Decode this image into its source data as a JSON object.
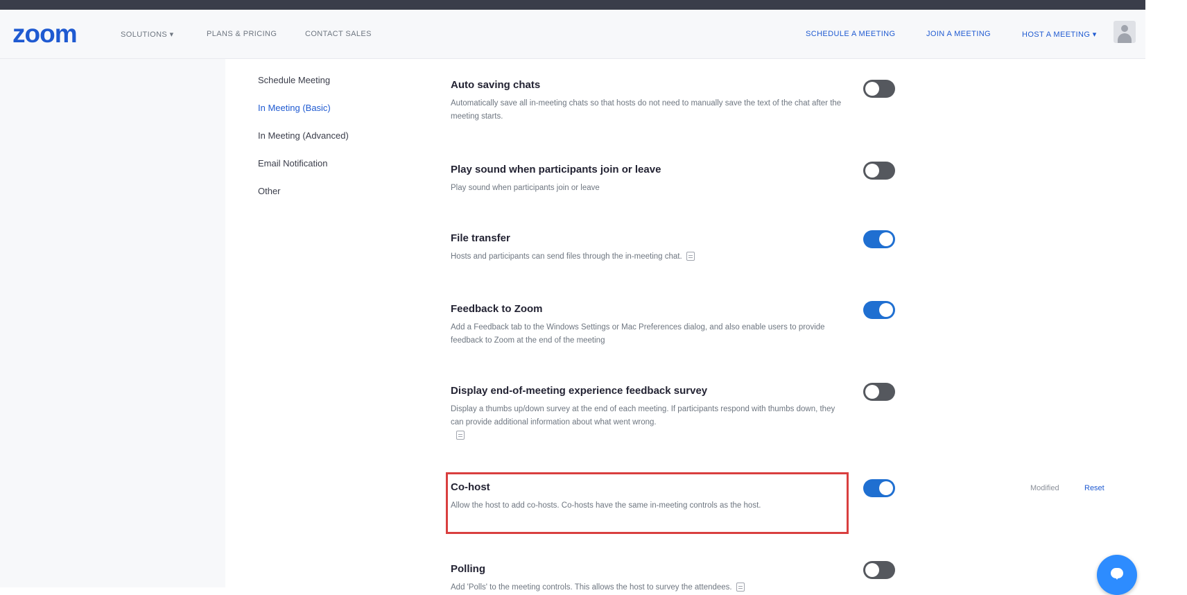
{
  "header": {
    "logo": "zoom",
    "nav_left": [
      "SOLUTIONS ▾",
      "PLANS & PRICING",
      "CONTACT SALES"
    ],
    "nav_right": [
      "SCHEDULE A MEETING",
      "JOIN A MEETING",
      "HOST A MEETING ▾"
    ],
    "avatar_icon": "user-avatar-icon"
  },
  "sidebar": {
    "items": [
      {
        "label": "Schedule Meeting",
        "active": false
      },
      {
        "label": "In Meeting (Basic)",
        "active": true
      },
      {
        "label": "In Meeting (Advanced)",
        "active": false
      },
      {
        "label": "Email Notification",
        "active": false
      },
      {
        "label": "Other",
        "active": false
      }
    ]
  },
  "settings": [
    {
      "title": "Auto saving chats",
      "description": "Automatically save all in-meeting chats so that hosts do not need to manually save the text of the chat after the meeting starts.",
      "enabled": false
    },
    {
      "title": "Play sound when participants join or leave",
      "description": "Play sound when participants join or leave",
      "enabled": false
    },
    {
      "title": "File transfer",
      "description": "Hosts and participants can send files through the in-meeting chat.",
      "enabled": true
    },
    {
      "title": "Feedback to Zoom",
      "description": "Add a Feedback tab to the Windows Settings or Mac Preferences dialog, and also enable users to provide feedback to Zoom at the end of the meeting",
      "enabled": true
    },
    {
      "title": "Display end-of-meeting experience feedback survey",
      "description": "Display a thumbs up/down survey at the end of each meeting. If participants respond with thumbs down, they can provide additional information about what went wrong.",
      "enabled": false
    },
    {
      "title": "Co-host",
      "description": "Allow the host to add co-hosts. Co-hosts have the same in-meeting controls as the host.",
      "enabled": true
    },
    {
      "title": "Polling",
      "description": "Add 'Polls' to the meeting controls. This allows the host to survey the attendees.",
      "enabled": false
    }
  ],
  "cohost_status": {
    "modified": "Modified",
    "reset": "Reset"
  },
  "colors": {
    "accent": "#1f5ad1",
    "toggle_on": "#1f6fd1",
    "toggle_off": "#55585e",
    "highlight": "#d93f3f",
    "chat_fab": "#2d8cff"
  },
  "chat_fab_icon": "chat-bubble-icon"
}
